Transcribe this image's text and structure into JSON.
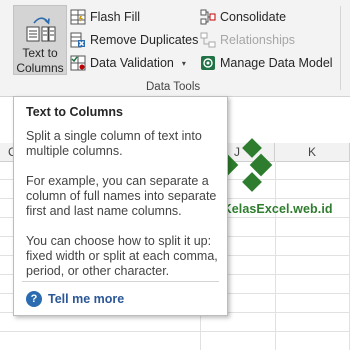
{
  "ribbon": {
    "text_to_columns": {
      "line1": "Text to",
      "line2": "Columns"
    },
    "flash_fill": "Flash Fill",
    "remove_duplicates": "Remove Duplicates",
    "data_validation": "Data Validation",
    "data_validation_caret": "▾",
    "consolidate": "Consolidate",
    "relationships": "Relationships",
    "manage_data_model": "Manage Data Model",
    "group_label": "Data Tools",
    "right_stub": " ",
    "colors": {
      "ribbon_bg": "#f3f3f3",
      "pressed": "#d4d4d4",
      "accent_green": "#217346",
      "disabled": "#a6a6a6"
    }
  },
  "sheet": {
    "col_partial_left": "C",
    "col_j": "J",
    "col_k": "K"
  },
  "tooltip": {
    "title": "Text to Columns",
    "p1": "Split a single column of text into multiple columns.",
    "p2": "For example, you can separate a column of full names into separate first and last name columns.",
    "p3": "You can choose how to split it up: fixed width or split at each comma, period, or other character.",
    "help_icon": "?",
    "tell_me_more": "Tell me more"
  },
  "watermark": {
    "text": "www.KelasExcel.web.id",
    "color": "#2e7d2e"
  }
}
